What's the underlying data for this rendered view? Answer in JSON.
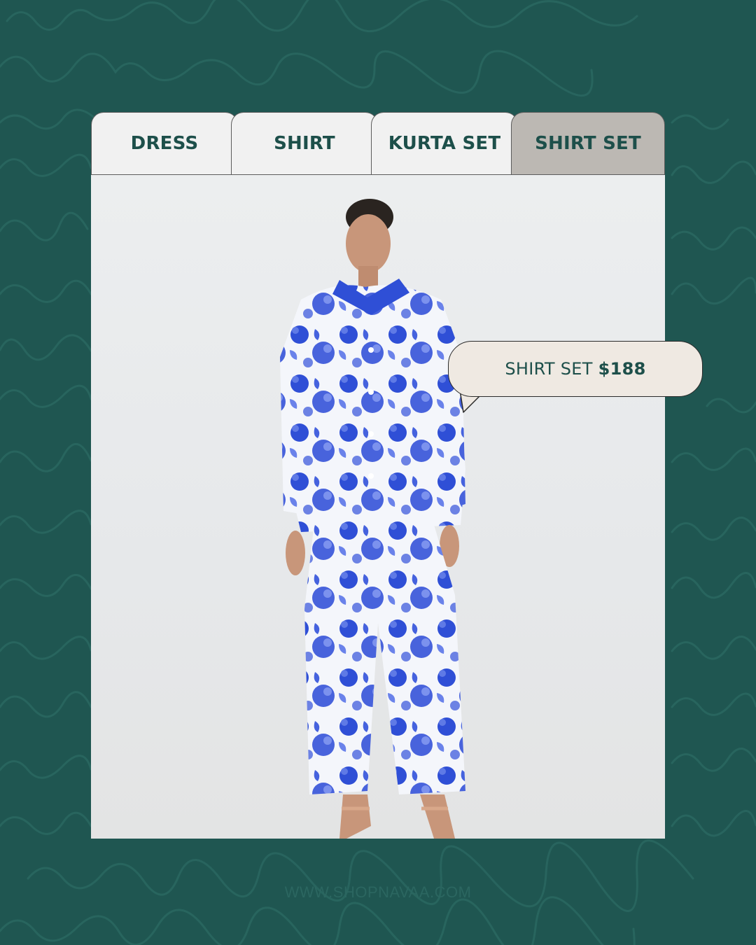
{
  "tabs": [
    {
      "label": "DRESS",
      "active": false
    },
    {
      "label": "SHIRT",
      "active": false
    },
    {
      "label": "KURTA SET",
      "active": false
    },
    {
      "label": "SHIRT SET",
      "active": true
    }
  ],
  "price_tag": {
    "name": "SHIRT SET",
    "price": "$188"
  },
  "footer": {
    "url": "WWW.SHOPNAVAA.COM"
  },
  "colors": {
    "background": "#1f5651",
    "accent_text": "#1d4f4a",
    "tab_inactive": "#f1f1f1",
    "tab_active": "#bcb8b3",
    "bubble": "#efe9e2",
    "print_blue": "#2f4fd6"
  },
  "icons": {
    "speech_bubble": "speech-bubble-tail"
  }
}
